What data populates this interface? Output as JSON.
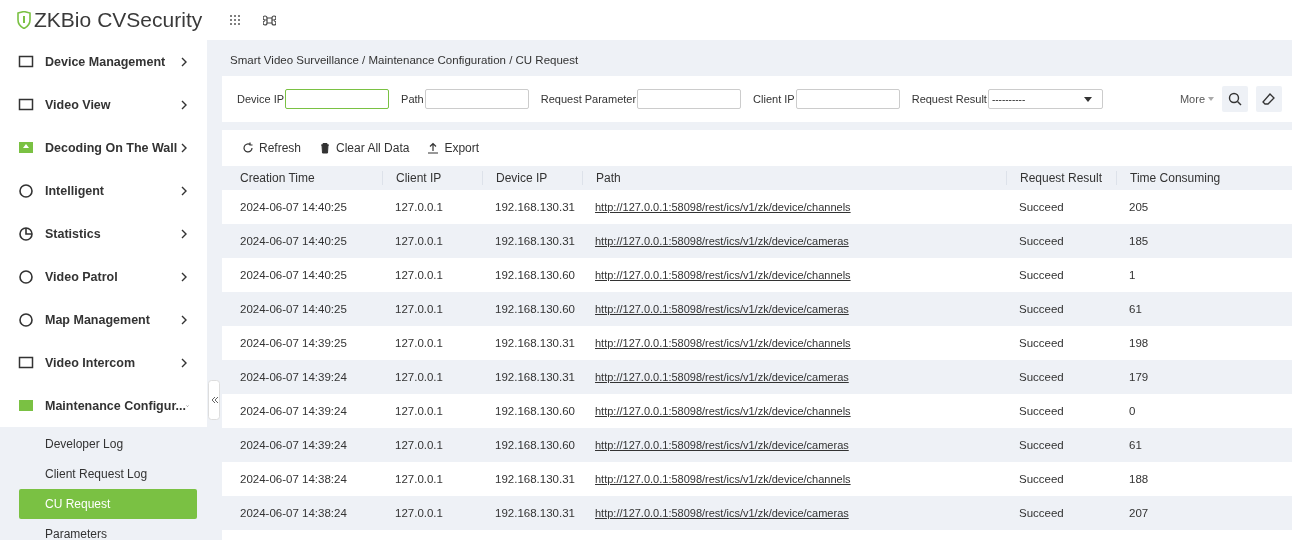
{
  "header": {
    "logo": {
      "brand": "ZKBio",
      "product": "CVSecurity"
    }
  },
  "sidebar": {
    "items": [
      {
        "label": "Device Management",
        "expanded": false
      },
      {
        "label": "Video View",
        "expanded": false
      },
      {
        "label": "Decoding On The Wall",
        "expanded": false
      },
      {
        "label": "Intelligent",
        "expanded": false
      },
      {
        "label": "Statistics",
        "expanded": false
      },
      {
        "label": "Video Patrol",
        "expanded": false
      },
      {
        "label": "Map Management",
        "expanded": false
      },
      {
        "label": "Video Intercom",
        "expanded": false
      },
      {
        "label": "Maintenance Configur...",
        "expanded": true,
        "children": [
          {
            "label": "Developer Log",
            "selected": false
          },
          {
            "label": "Client Request Log",
            "selected": false
          },
          {
            "label": "CU Request",
            "selected": true
          },
          {
            "label": "Parameters",
            "selected": false
          }
        ]
      }
    ]
  },
  "breadcrumb": "Smart Video Surveillance / Maintenance Configuration / CU Request",
  "filters": [
    {
      "label": "Device IP",
      "kind": "text",
      "focused": true
    },
    {
      "label": "Path",
      "kind": "text",
      "focused": false
    },
    {
      "label": "Request Parameter",
      "kind": "text",
      "focused": false
    },
    {
      "label": "Client IP",
      "kind": "text",
      "focused": false
    },
    {
      "label": "Request Result",
      "kind": "select",
      "value": "----------",
      "focused": false
    }
  ],
  "more": "More",
  "toolbar": [
    "Refresh",
    "Clear All Data",
    "Export"
  ],
  "table": {
    "columns": [
      "Creation Time",
      "Client IP",
      "Device IP",
      "Path",
      "Request Result",
      "Time Consuming"
    ],
    "rows": [
      [
        "2024-06-07 14:40:25",
        "127.0.0.1",
        "192.168.130.31",
        "http://127.0.0.1:58098/rest/ics/v1/zk/device/channels",
        "Succeed",
        "205"
      ],
      [
        "2024-06-07 14:40:25",
        "127.0.0.1",
        "192.168.130.31",
        "http://127.0.0.1:58098/rest/ics/v1/zk/device/cameras",
        "Succeed",
        "185"
      ],
      [
        "2024-06-07 14:40:25",
        "127.0.0.1",
        "192.168.130.60",
        "http://127.0.0.1:58098/rest/ics/v1/zk/device/channels",
        "Succeed",
        "1"
      ],
      [
        "2024-06-07 14:40:25",
        "127.0.0.1",
        "192.168.130.60",
        "http://127.0.0.1:58098/rest/ics/v1/zk/device/cameras",
        "Succeed",
        "61"
      ],
      [
        "2024-06-07 14:39:25",
        "127.0.0.1",
        "192.168.130.31",
        "http://127.0.0.1:58098/rest/ics/v1/zk/device/channels",
        "Succeed",
        "198"
      ],
      [
        "2024-06-07 14:39:24",
        "127.0.0.1",
        "192.168.130.31",
        "http://127.0.0.1:58098/rest/ics/v1/zk/device/cameras",
        "Succeed",
        "179"
      ],
      [
        "2024-06-07 14:39:24",
        "127.0.0.1",
        "192.168.130.60",
        "http://127.0.0.1:58098/rest/ics/v1/zk/device/channels",
        "Succeed",
        "0"
      ],
      [
        "2024-06-07 14:39:24",
        "127.0.0.1",
        "192.168.130.60",
        "http://127.0.0.1:58098/rest/ics/v1/zk/device/cameras",
        "Succeed",
        "61"
      ],
      [
        "2024-06-07 14:38:24",
        "127.0.0.1",
        "192.168.130.31",
        "http://127.0.0.1:58098/rest/ics/v1/zk/device/channels",
        "Succeed",
        "188"
      ],
      [
        "2024-06-07 14:38:24",
        "127.0.0.1",
        "192.168.130.31",
        "http://127.0.0.1:58098/rest/ics/v1/zk/device/cameras",
        "Succeed",
        "207"
      ]
    ]
  }
}
